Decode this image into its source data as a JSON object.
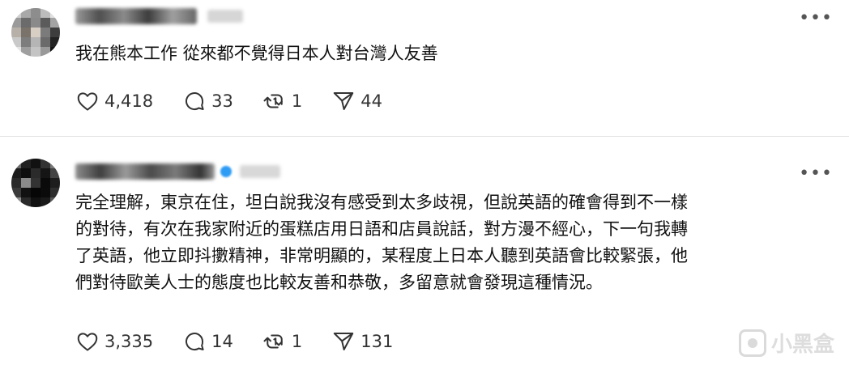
{
  "posts": [
    {
      "text": "我在熊本工作 從來都不覺得日本人對台灣人友善",
      "likes": "4,418",
      "comments": "33",
      "reposts": "1",
      "shares": "44"
    },
    {
      "text": "完全理解，東京在住，坦白說我沒有感受到太多歧視，但說英語的確會得到不一樣\n的對待，有次在我家附近的蛋糕店用日語和店員說話，對方漫不經心，下一句我轉\n了英語，他立即抖擻精神，非常明顯的，某程度上日本人聽到英語會比較緊張，他\n們對待歐美人士的態度也比較友善和恭敬，多留意就會發現這種情況。",
      "likes": "3,335",
      "comments": "14",
      "reposts": "1",
      "shares": "131"
    }
  ],
  "icons": {
    "like": "heart-icon",
    "comment": "comment-bubble-icon",
    "repost": "repost-icon",
    "share": "send-icon",
    "more": "more-horizontal-icon"
  },
  "watermark": {
    "text": "小黑盒"
  },
  "colors": {
    "verified": "#2e9bf5",
    "icon_stroke": "#333333",
    "divider": "#e3e3e3"
  }
}
